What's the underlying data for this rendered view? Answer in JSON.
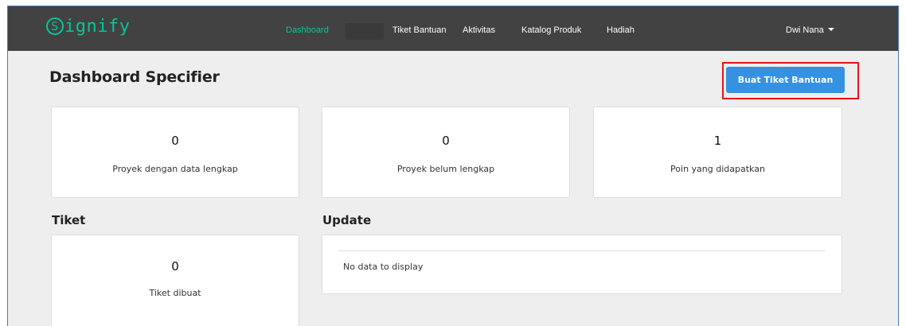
{
  "brand": {
    "s_letter": "S",
    "rest": "ignify",
    "color": "#00c89a"
  },
  "nav": {
    "links": [
      {
        "label": "Dashboard",
        "active": true
      },
      {
        "label": "Tiket Bantuan",
        "active": false
      },
      {
        "label": "Aktivitas",
        "active": false
      },
      {
        "label": "Katalog Produk",
        "active": false
      },
      {
        "label": "Hadiah",
        "active": false
      }
    ],
    "user_name": "Dwi Nana",
    "user_menu_icon": "caret-down-icon"
  },
  "page": {
    "title": "Dashboard Specifier"
  },
  "actions": {
    "create_ticket_label": "Buat Tiket Bantuan",
    "primary_color": "#3592e3",
    "highlight_color": "#e8141b"
  },
  "stats": [
    {
      "value": "0",
      "label": "Proyek dengan data lengkap"
    },
    {
      "value": "0",
      "label": "Proyek belum lengkap"
    },
    {
      "value": "1",
      "label": "Poin yang didapatkan"
    }
  ],
  "tickets": {
    "title": "Tiket",
    "value": "0",
    "label": "Tiket dibuat"
  },
  "updates": {
    "title": "Update",
    "empty_text": "No data to display"
  }
}
